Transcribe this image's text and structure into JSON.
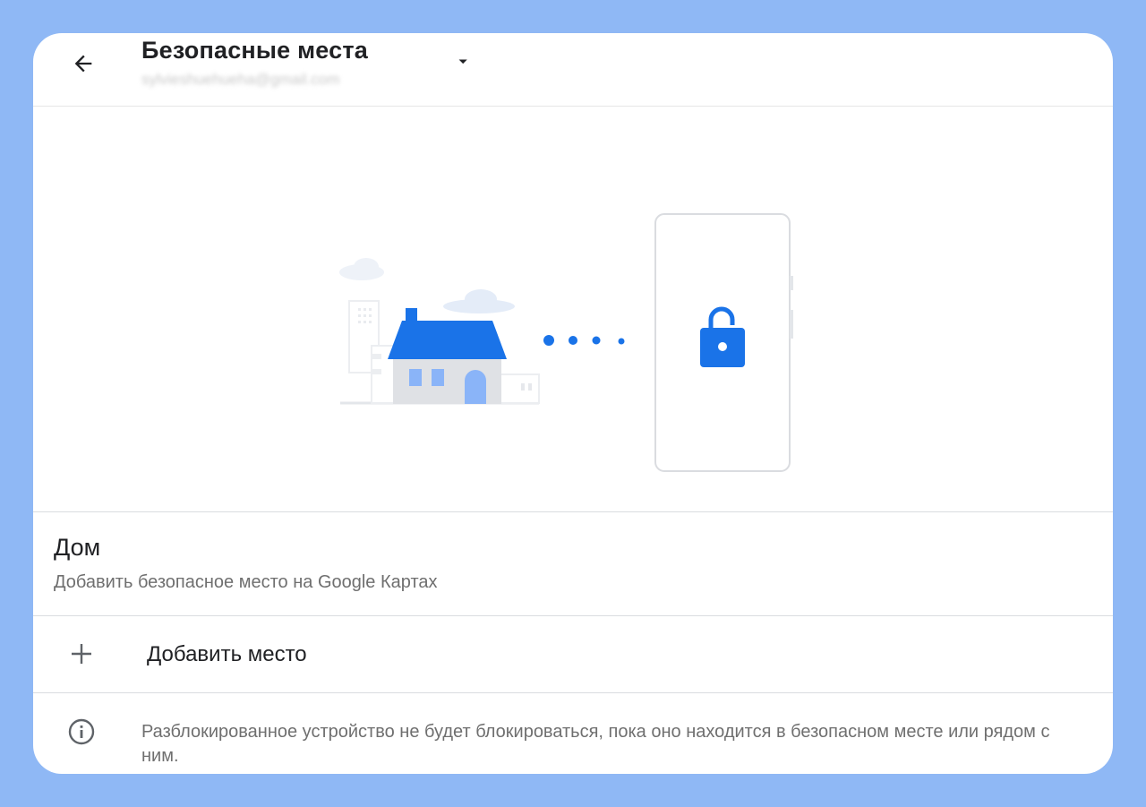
{
  "header": {
    "title": "Безопасные места",
    "account": "sylvieshuehueha@gmail.com",
    "back_icon": "arrow-back-icon",
    "dropdown_icon": "arrow-drop-down-icon"
  },
  "illustration": {
    "house_icon": "house-icon",
    "phone_icon": "phone-icon",
    "lock_icon": "unlocked-padlock-icon",
    "accent_color": "#1a73e8"
  },
  "home": {
    "title": "Дом",
    "subtitle": "Добавить безопасное место на Google Картах"
  },
  "add_place": {
    "icon": "plus-icon",
    "label": "Добавить место"
  },
  "info": {
    "icon": "info-icon",
    "text": "Разблокированное устройство не будет блокироваться, пока оно находится в безопасном месте или рядом с ним."
  },
  "colors": {
    "background": "#8fb8f5",
    "card": "#ffffff",
    "primary_text": "#202124",
    "secondary_text": "#6f6f6f"
  }
}
